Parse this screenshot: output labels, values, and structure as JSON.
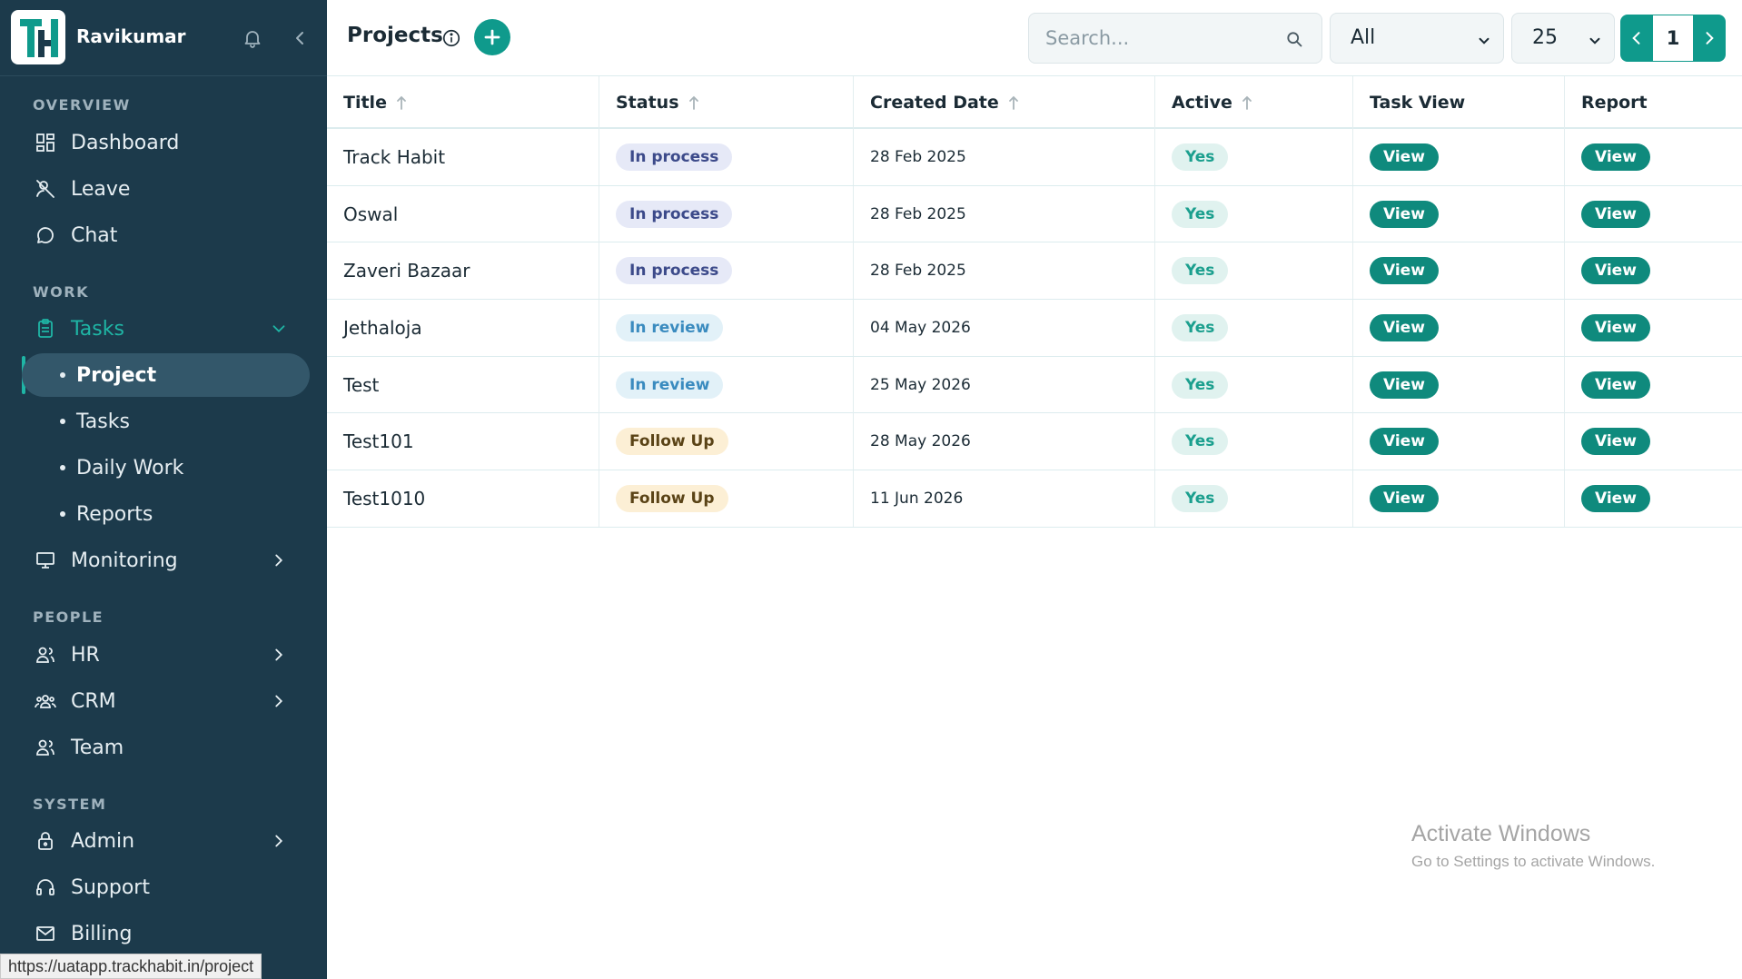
{
  "sidebar": {
    "user_name": "Ravikumar",
    "sections": {
      "overview": "OVERVIEW",
      "work": "WORK",
      "people": "PEOPLE",
      "system": "SYSTEM"
    },
    "items": {
      "dashboard": "Dashboard",
      "leave": "Leave",
      "chat": "Chat",
      "tasks": "Tasks",
      "monitoring": "Monitoring",
      "hr": "HR",
      "crm": "CRM",
      "team": "Team",
      "admin": "Admin",
      "support": "Support",
      "billing": "Billing"
    },
    "sub_items": {
      "project": "Project",
      "tasks": "Tasks",
      "daily_work": "Daily Work",
      "reports": "Reports"
    },
    "accent_color": "#1fb5a5",
    "background_color": "#1c3a4b"
  },
  "header": {
    "title": "Projects",
    "search_placeholder": "Search...",
    "filter_value": "All",
    "page_size": "25",
    "current_page": "1"
  },
  "table": {
    "columns": [
      "Title",
      "Status",
      "Created Date",
      "Active",
      "Task View",
      "Report"
    ],
    "rows": [
      {
        "title": "Track Habit",
        "status": "In process",
        "status_type": "process",
        "created": "28 Feb 2025",
        "active": "Yes",
        "task_view": "View",
        "report": "View"
      },
      {
        "title": "Oswal",
        "status": "In process",
        "status_type": "process",
        "created": "28 Feb 2025",
        "active": "Yes",
        "task_view": "View",
        "report": "View"
      },
      {
        "title": "Zaveri Bazaar",
        "status": "In process",
        "status_type": "process",
        "created": "28 Feb 2025",
        "active": "Yes",
        "task_view": "View",
        "report": "View"
      },
      {
        "title": "Jethaloja",
        "status": "In review",
        "status_type": "review",
        "created": "04 May 2026",
        "active": "Yes",
        "task_view": "View",
        "report": "View"
      },
      {
        "title": "Test",
        "status": "In review",
        "status_type": "review",
        "created": "25 May 2026",
        "active": "Yes",
        "task_view": "View",
        "report": "View"
      },
      {
        "title": "Test101",
        "status": "Follow Up",
        "status_type": "follow",
        "created": "28 May 2026",
        "active": "Yes",
        "task_view": "View",
        "report": "View"
      },
      {
        "title": "Test1010",
        "status": "Follow Up",
        "status_type": "follow",
        "created": "11 Jun 2026",
        "active": "Yes",
        "task_view": "View",
        "report": "View"
      }
    ]
  },
  "status_bar_url": "https://uatapp.trackhabit.in/project",
  "watermark": {
    "line1": "Activate Windows",
    "line2": "Go to Settings to activate Windows."
  },
  "primary_color": "#0f9a8c"
}
